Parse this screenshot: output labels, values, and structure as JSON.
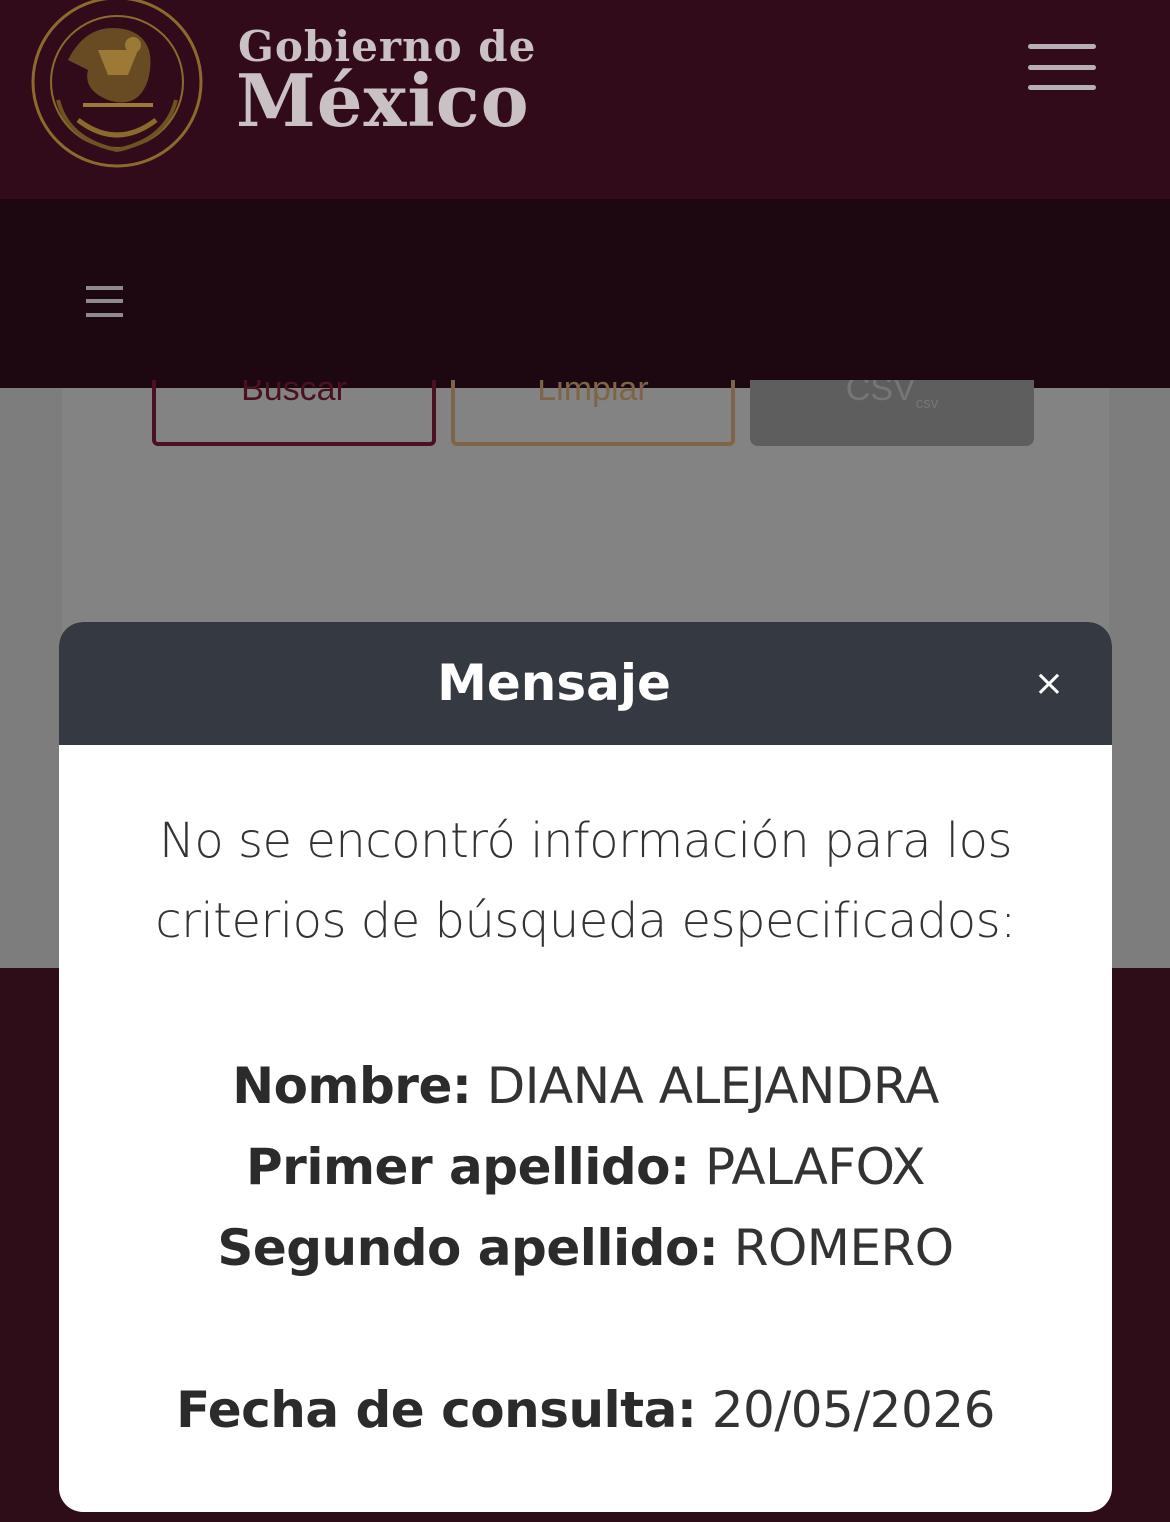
{
  "header": {
    "brand_top": "Gobierno de",
    "brand_bottom": "México"
  },
  "page": {
    "buttons": {
      "search": "Buscar",
      "clear": "Limpiar",
      "csv": "CSV",
      "csv_sub": "csv"
    }
  },
  "modal": {
    "title": "Mensaje",
    "close": "×",
    "message_line1": "No se encontró información para los",
    "message_line2": "criterios de búsqueda especificados:",
    "fields": [
      {
        "label": "Nombre:",
        "value": "DIANA ALEJANDRA"
      },
      {
        "label": "Primer apellido:",
        "value": "PALAFOX"
      },
      {
        "label": "Segundo apellido:",
        "value": "ROMERO"
      },
      {
        "label": "Fecha de consulta:",
        "value": "20/05/2026"
      }
    ]
  },
  "colors": {
    "header_bg": "#320b1a",
    "subnav_bg": "#1d0710",
    "modal_header_bg": "#353a42",
    "gold": "#b58a3e"
  }
}
